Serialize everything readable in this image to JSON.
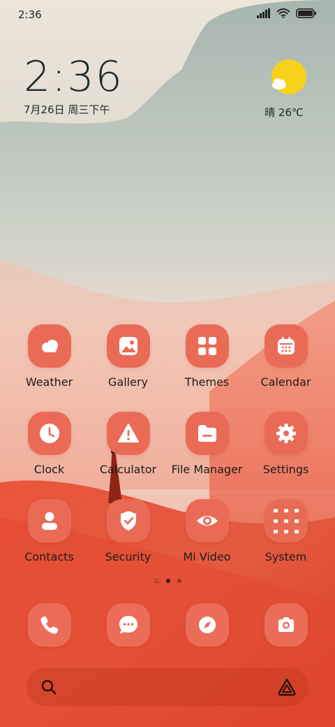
{
  "status_bar": {
    "time": "2:36"
  },
  "clock_widget": {
    "time": "2:36",
    "date": "7月26日 周三下午"
  },
  "weather_widget": {
    "condition": "晴",
    "temperature": "26℃",
    "icon": "sun-cloud-icon"
  },
  "apps": [
    {
      "label": "Weather",
      "icon": "cloud-icon"
    },
    {
      "label": "Gallery",
      "icon": "image-icon"
    },
    {
      "label": "Themes",
      "icon": "grid-icon"
    },
    {
      "label": "Calendar",
      "icon": "calendar-icon"
    },
    {
      "label": "Clock",
      "icon": "clock-icon"
    },
    {
      "label": "Calculator",
      "icon": "warning-icon"
    },
    {
      "label": "File Manager",
      "icon": "folder-icon"
    },
    {
      "label": "Settings",
      "icon": "gear-icon"
    },
    {
      "label": "Contacts",
      "icon": "person-icon"
    },
    {
      "label": "Security",
      "icon": "shield-icon"
    },
    {
      "label": "Mi Video",
      "icon": "eye-icon"
    },
    {
      "label": "System",
      "icon": "folder-grid-icon"
    }
  ],
  "dock": [
    {
      "icon": "phone-icon"
    },
    {
      "icon": "message-icon"
    },
    {
      "icon": "compass-icon"
    },
    {
      "icon": "camera-icon"
    }
  ],
  "pager": {
    "pages": 2,
    "active": 0
  },
  "colors": {
    "accent": "#ea6b55",
    "text": "#1d1d1d"
  }
}
